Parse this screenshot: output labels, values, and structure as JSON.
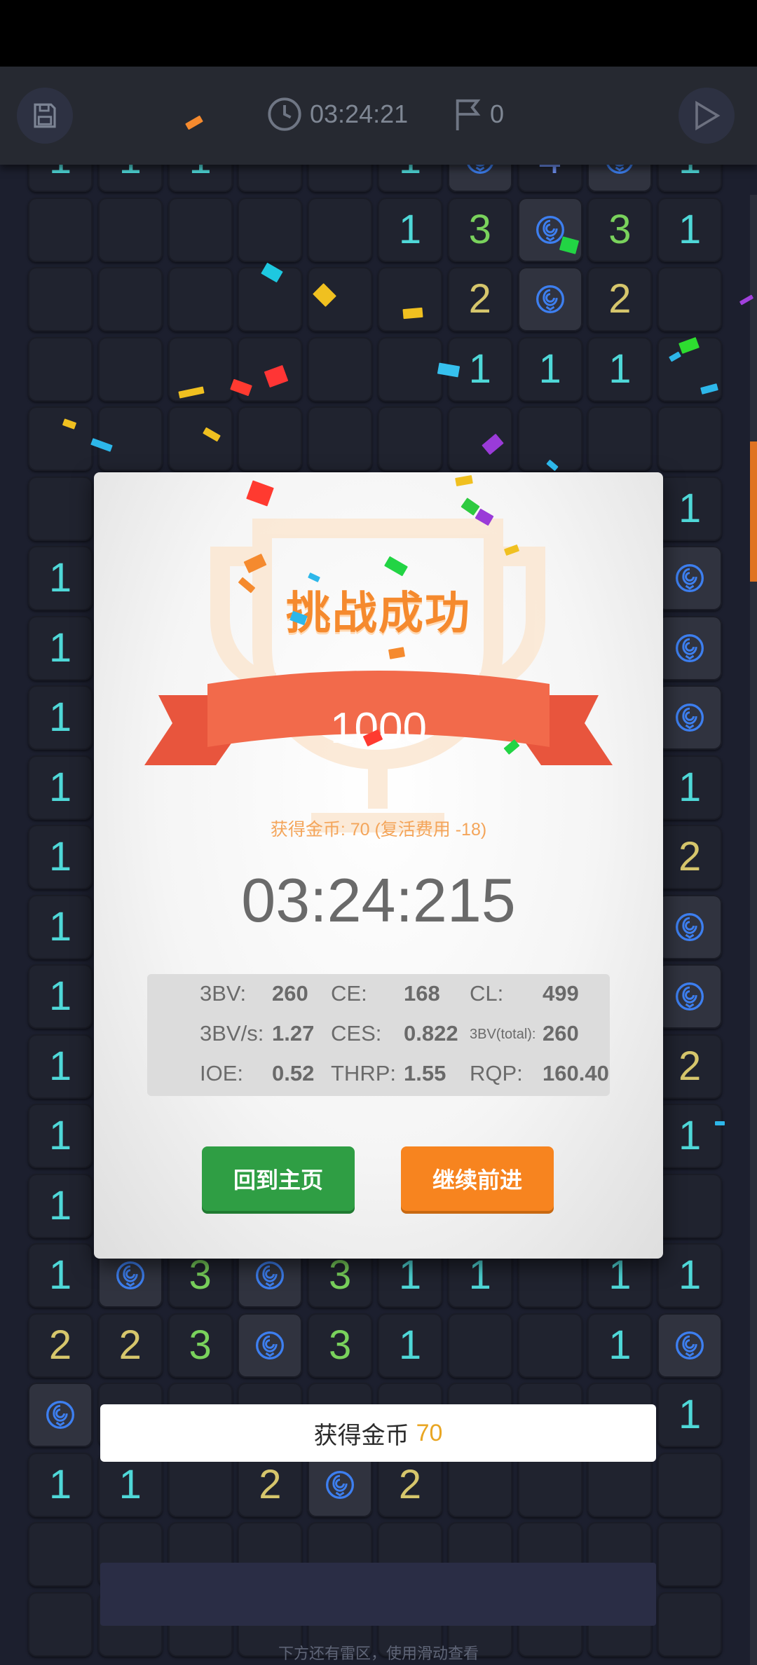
{
  "topbar": {
    "save_icon": "save-icon",
    "timer": "03:24:21",
    "flags": "0",
    "play_icon": "play-icon"
  },
  "board": {
    "mine_icon": "rose-icon",
    "rows": [
      [
        "1",
        "1",
        "1",
        "",
        "",
        "1",
        "M",
        "4",
        "M",
        "1"
      ],
      [
        "",
        "",
        "",
        "",
        "",
        "1",
        "3",
        "M",
        "3",
        "1"
      ],
      [
        "",
        "",
        "",
        "",
        "",
        "",
        "2",
        "M",
        "2",
        ""
      ],
      [
        "",
        "",
        "",
        "",
        "",
        "",
        "1",
        "1",
        "1",
        ""
      ],
      [
        "",
        "",
        "",
        "",
        "",
        "",
        "",
        "",
        "",
        ""
      ],
      [
        "",
        "",
        "",
        "",
        "",
        "",
        "",
        "",
        "",
        "1"
      ],
      [
        "1",
        "",
        "",
        "",
        "",
        "",
        "",
        "",
        "",
        "M"
      ],
      [
        "1",
        "",
        "",
        "",
        "",
        "",
        "",
        "",
        "",
        "M"
      ],
      [
        "1",
        "",
        "",
        "",
        "",
        "",
        "",
        "",
        "",
        "M"
      ],
      [
        "1",
        "",
        "",
        "",
        "",
        "",
        "",
        "",
        "",
        "1"
      ],
      [
        "1",
        "",
        "",
        "",
        "",
        "",
        "",
        "",
        "",
        "2"
      ],
      [
        "1",
        "",
        "",
        "",
        "",
        "",
        "",
        "",
        "",
        "M"
      ],
      [
        "1",
        "",
        "",
        "",
        "",
        "",
        "",
        "",
        "",
        "M"
      ],
      [
        "1",
        "",
        "",
        "",
        "",
        "",
        "",
        "",
        "",
        "2"
      ],
      [
        "1",
        "",
        "",
        "",
        "",
        "",
        "",
        "",
        "",
        "1"
      ],
      [
        "1",
        "",
        "",
        "",
        "",
        "",
        "",
        "",
        "",
        ""
      ],
      [
        "1",
        "M",
        "3",
        "M",
        "3",
        "1",
        "1",
        "",
        "1",
        "1"
      ],
      [
        "2",
        "2",
        "3",
        "M",
        "3",
        "1",
        "",
        "",
        "1",
        "M"
      ],
      [
        "M",
        "",
        "",
        "",
        "",
        "",
        "",
        "",
        "",
        "1"
      ],
      [
        "1",
        "1",
        "",
        "2",
        "M",
        "2",
        "",
        "",
        "",
        ""
      ],
      [
        "",
        "",
        "",
        "",
        "",
        "",
        "",
        "",
        "",
        ""
      ],
      [
        "",
        "",
        "",
        "",
        "",
        "",
        "",
        "",
        "",
        ""
      ]
    ]
  },
  "dialog": {
    "title": "挑战成功",
    "score": "1000",
    "coins_line": "获得金币: 70 (复活费用 -18)",
    "time": "03:24:215",
    "stats": [
      {
        "label": "3BV:",
        "value": "260"
      },
      {
        "label": "CE:",
        "value": "168"
      },
      {
        "label": "CL:",
        "value": "499"
      },
      {
        "label": "3BV/s:",
        "value": "1.27"
      },
      {
        "label": "CES:",
        "value": "0.822"
      },
      {
        "label": "3BV(total):",
        "value": "260"
      },
      {
        "label": "IOE:",
        "value": "0.52"
      },
      {
        "label": "THRP:",
        "value": "1.55"
      },
      {
        "label": "RQP:",
        "value": "160.40"
      }
    ],
    "home_button": "回到主页",
    "continue_button": "继续前进"
  },
  "toast": {
    "label": "获得金币",
    "value": "70"
  },
  "footer_hint": "下方还有雷区，使用滑动查看",
  "colors": {
    "accent_orange": "#f7841f",
    "accent_green": "#2f9e44",
    "mine_blue": "#3d7ff0"
  }
}
